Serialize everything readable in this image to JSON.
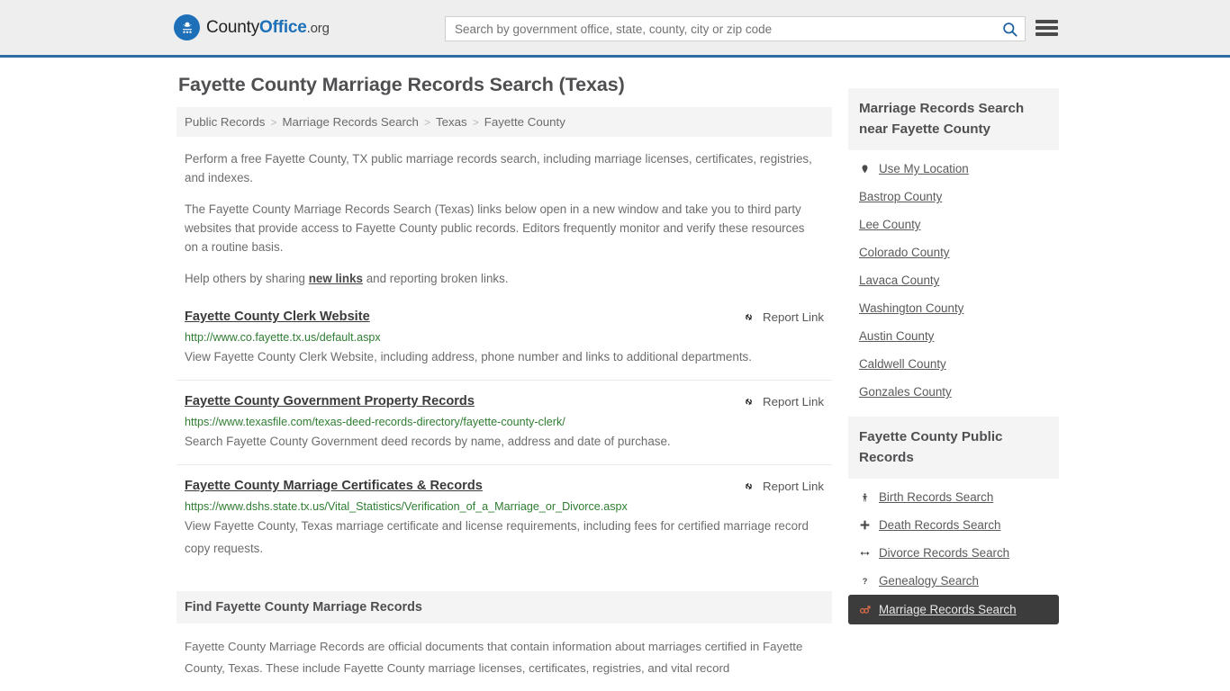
{
  "header": {
    "brand": {
      "prefix": "County",
      "accent": "Office",
      "suffix": ".org",
      "logo_icon": "eagle-shield-logo-icon"
    },
    "search": {
      "placeholder": "Search by government office, state, county, city or zip code",
      "value": "",
      "button_icon": "search-icon"
    },
    "menu_icon": "hamburger-menu-icon"
  },
  "main": {
    "title": "Fayette County Marriage Records Search (Texas)",
    "breadcrumb": [
      "Public Records",
      "Marriage Records Search",
      "Texas",
      "Fayette County"
    ],
    "breadcrumb_separator": ">",
    "intro": {
      "p1": "Perform a free Fayette County, TX public marriage records search, including marriage licenses, certificates, registries, and indexes.",
      "p2": "The Fayette County Marriage Records Search (Texas) links below open in a new window and take you to third party websites that provide access to Fayette County public records. Editors frequently monitor and verify these resources on a routine basis.",
      "p3_before": "Help others by sharing ",
      "p3_link": "new links",
      "p3_after": " and reporting broken links."
    },
    "report_link_label": "Report Link",
    "report_link_icon": "broken-link-icon",
    "results": [
      {
        "title": "Fayette County Clerk Website",
        "url": "http://www.co.fayette.tx.us/default.aspx",
        "description": "View Fayette County Clerk Website, including address, phone number and links to additional departments."
      },
      {
        "title": "Fayette County Government Property Records",
        "url": "https://www.texasfile.com/texas-deed-records-directory/fayette-county-clerk/",
        "description": "Search Fayette County Government deed records by name, address and date of purchase."
      },
      {
        "title": "Fayette County Marriage Certificates & Records",
        "url": "https://www.dshs.state.tx.us/Vital_Statistics/Verification_of_a_Marriage_or_Divorce.aspx",
        "description": "View Fayette County, Texas marriage certificate and license requirements, including fees for certified marriage record copy requests."
      }
    ],
    "find_section": {
      "heading": "Find Fayette County Marriage Records",
      "body": "Fayette County Marriage Records are official documents that contain information about marriages certified in Fayette County, Texas. These include Fayette County marriage licenses, certificates, registries, and vital record"
    }
  },
  "sidebar": {
    "nearby": {
      "heading": "Marriage Records Search near Fayette County",
      "items": [
        {
          "label": "Use My Location",
          "icon": "location-pin-icon"
        },
        {
          "label": "Bastrop County",
          "icon": ""
        },
        {
          "label": "Lee County",
          "icon": ""
        },
        {
          "label": "Colorado County",
          "icon": ""
        },
        {
          "label": "Lavaca County",
          "icon": ""
        },
        {
          "label": "Washington County",
          "icon": ""
        },
        {
          "label": "Austin County",
          "icon": ""
        },
        {
          "label": "Caldwell County",
          "icon": ""
        },
        {
          "label": "Gonzales County",
          "icon": ""
        }
      ]
    },
    "public_records": {
      "heading": "Fayette County Public Records",
      "items": [
        {
          "label": "Birth Records Search",
          "icon": "baby-icon",
          "active": false
        },
        {
          "label": "Death Records Search",
          "icon": "cross-icon",
          "active": false
        },
        {
          "label": "Divorce Records Search",
          "icon": "left-right-arrow-icon",
          "active": false
        },
        {
          "label": "Genealogy Search",
          "icon": "question-mark-icon",
          "active": false
        },
        {
          "label": "Marriage Records Search",
          "icon": "male-female-icon",
          "active": true
        }
      ]
    }
  },
  "colors": {
    "brand_blue": "#1d6fb8",
    "header_border": "#2e6da4",
    "url_green": "#2f7d32",
    "active_bg": "#3c3c3c",
    "active_icon": "#e8704a"
  }
}
